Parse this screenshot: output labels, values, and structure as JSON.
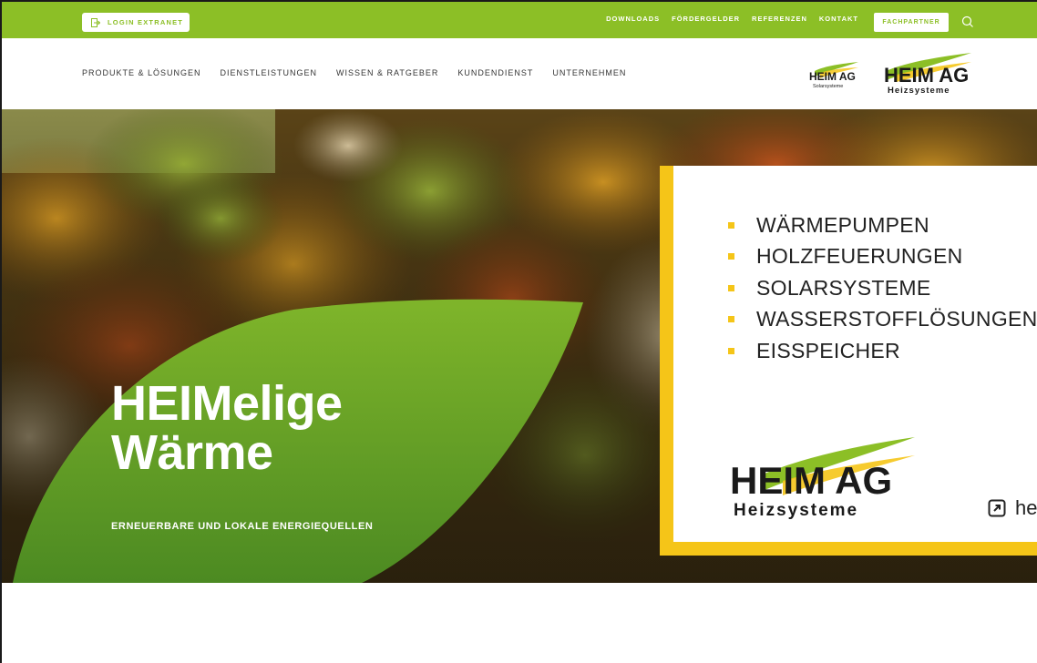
{
  "topbar": {
    "login_label": "LOGIN EXTRANET",
    "links": [
      "DOWNLOADS",
      "FÖRDERGELDER",
      "REFERENZEN",
      "KONTAKT"
    ],
    "fachpartner_label": "FACHPARTNER"
  },
  "nav": {
    "items": [
      "PRODUKTE & LÖSUNGEN",
      "DIENSTLEISTUNGEN",
      "WISSEN & RATGEBER",
      "KUNDENDIENST",
      "UNTERNEHMEN"
    ]
  },
  "logos": {
    "solar": {
      "line1": "HEIM AG",
      "line2": "Solarsysteme"
    },
    "heiz": {
      "line1": "HEIM AG",
      "line2": "Heizsysteme"
    }
  },
  "hero": {
    "title_line1": "HEIMelige",
    "title_line2": "Wärme",
    "subtitle": "ERNEUERBARE UND LOKALE ENERGIEQUELLEN"
  },
  "card": {
    "items": [
      "WÄRMEPUMPEN",
      "HOLZFEUERUNGEN",
      "SOLARSYSTEME",
      "WASSERSTOFFLÖSUNGEN",
      "EISSPEICHER"
    ],
    "logo": {
      "line1": "HEIM AG",
      "line2": "Heizsysteme"
    },
    "link_text": "heim-ag.ch"
  },
  "colors": {
    "brand_green": "#8cbf26",
    "accent_yellow": "#f5c518"
  }
}
